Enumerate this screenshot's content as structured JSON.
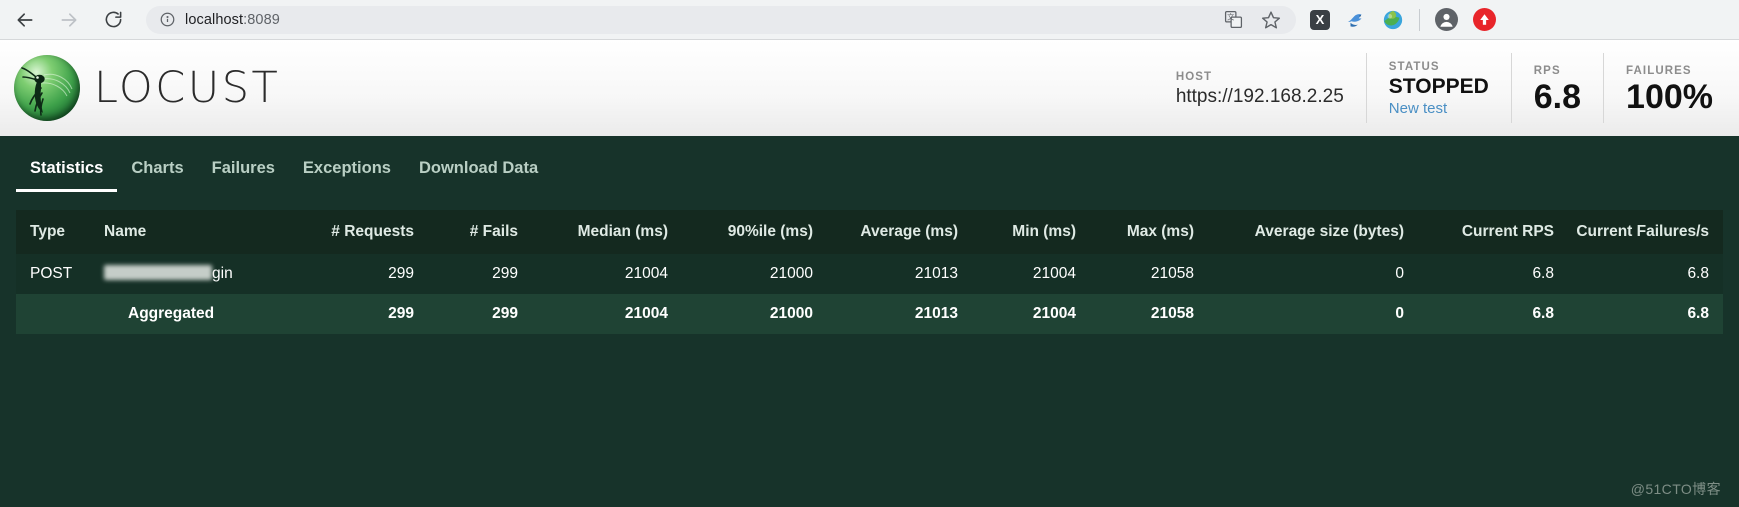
{
  "browser": {
    "url_host": "localhost",
    "url_port": ":8089",
    "back_icon": "back-arrow-icon",
    "forward_icon": "forward-arrow-icon",
    "reload_icon": "reload-icon",
    "info_icon": "site-info-icon",
    "translate_icon": "translate-icon",
    "bookmark_icon": "bookmark-star-icon",
    "ext_x_label": "X",
    "ext_bird_icon": "bird-extension-icon",
    "ext_globe_icon": "globe-extension-icon",
    "profile_icon": "profile-avatar-icon",
    "ext_red_icon": "red-upload-extension-icon"
  },
  "header": {
    "brand": "LOCUST",
    "logo_icon": "locust-logo-icon",
    "stats": {
      "host_label": "HOST",
      "host_value": "https://192.168.2.25",
      "status_label": "STATUS",
      "status_value": "STOPPED",
      "new_test_link": "New test",
      "rps_label": "RPS",
      "rps_value": "6.8",
      "failures_label": "FAILURES",
      "failures_value": "100%"
    }
  },
  "tabs": [
    {
      "label": "Statistics",
      "active": true
    },
    {
      "label": "Charts",
      "active": false
    },
    {
      "label": "Failures",
      "active": false
    },
    {
      "label": "Exceptions",
      "active": false
    },
    {
      "label": "Download Data",
      "active": false
    }
  ],
  "table": {
    "columns": [
      "Type",
      "Name",
      "# Requests",
      "# Fails",
      "Median (ms)",
      "90%ile (ms)",
      "Average (ms)",
      "Min (ms)",
      "Max (ms)",
      "Average size (bytes)",
      "Current RPS",
      "Current Failures/s"
    ],
    "rows": [
      {
        "type": "POST",
        "name_redacted": true,
        "name_suffix": "gin",
        "requests": "299",
        "fails": "299",
        "median": "21004",
        "p90": "21000",
        "average": "21013",
        "min": "21004",
        "max": "21058",
        "avg_size": "0",
        "current_rps": "6.8",
        "current_failures": "6.8"
      },
      {
        "type": "",
        "name": "Aggregated",
        "requests": "299",
        "fails": "299",
        "median": "21004",
        "p90": "21000",
        "average": "21013",
        "min": "21004",
        "max": "21058",
        "avg_size": "0",
        "current_rps": "6.8",
        "current_failures": "6.8"
      }
    ]
  },
  "watermark": "@51CTO博客",
  "colors": {
    "dark_green": "#17332a",
    "row_bg": "#153026",
    "agg_bg": "#1f4334",
    "link_blue": "#4a8fc4",
    "chrome_bg": "#f1f3f4"
  }
}
